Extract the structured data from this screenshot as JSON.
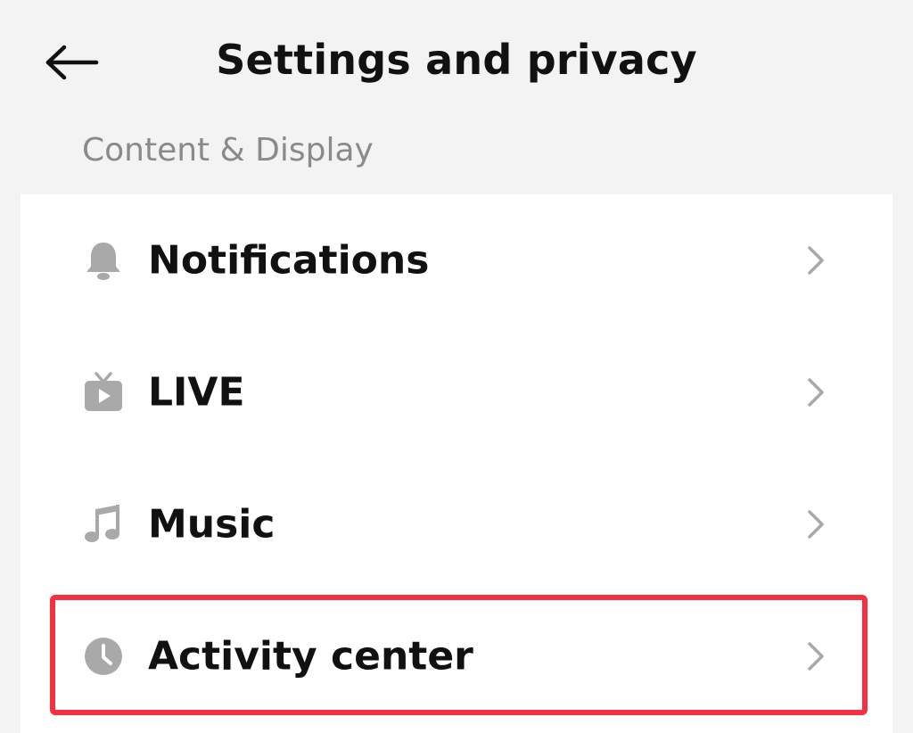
{
  "header": {
    "title": "Settings and privacy",
    "back_icon": "arrow-left-icon"
  },
  "section": {
    "label": "Content & Display"
  },
  "items": [
    {
      "label": "Notifications",
      "icon": "bell-icon"
    },
    {
      "label": "LIVE",
      "icon": "tv-icon"
    },
    {
      "label": "Music",
      "icon": "music-note-icon"
    },
    {
      "label": "Activity center",
      "icon": "clock-icon",
      "highlighted": true
    }
  ],
  "colors": {
    "background": "#f3f3f3",
    "card": "#ffffff",
    "text": "#111111",
    "muted": "#8a8a8a",
    "icon": "#a9a9a9",
    "highlight": "#f5313f"
  }
}
